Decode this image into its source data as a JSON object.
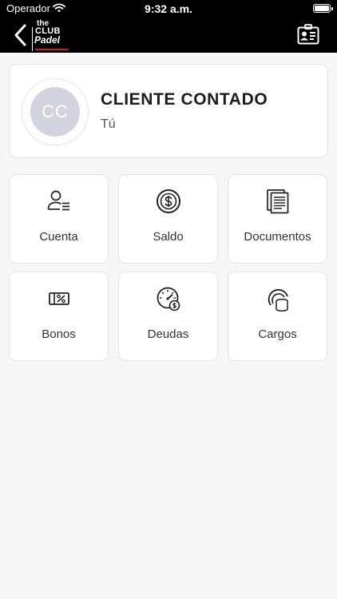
{
  "status_bar": {
    "carrier": "Operador",
    "time": "9:32 a.m.",
    "battery_level": 1.0
  },
  "header": {
    "logo": {
      "line1": "the",
      "line2": "CLUB",
      "line3": "Padel"
    }
  },
  "profile": {
    "initials": "CC",
    "name": "CLIENTE CONTADO",
    "role": "Tú",
    "avatar_color": "#d3d3e0"
  },
  "menu": {
    "tiles": [
      {
        "label": "Cuenta",
        "icon": "user-list-icon"
      },
      {
        "label": "Saldo",
        "icon": "dollar-coin-icon"
      },
      {
        "label": "Documentos",
        "icon": "documents-icon"
      },
      {
        "label": "Bonos",
        "icon": "percent-ticket-icon"
      },
      {
        "label": "Deudas",
        "icon": "gauge-debt-icon"
      },
      {
        "label": "Cargos",
        "icon": "coins-stack-icon"
      }
    ]
  },
  "colors": {
    "navbar_bg": "#000000",
    "page_bg": "#f7f7f7",
    "card_bg": "#ffffff",
    "logo_accent": "#c0202a"
  }
}
